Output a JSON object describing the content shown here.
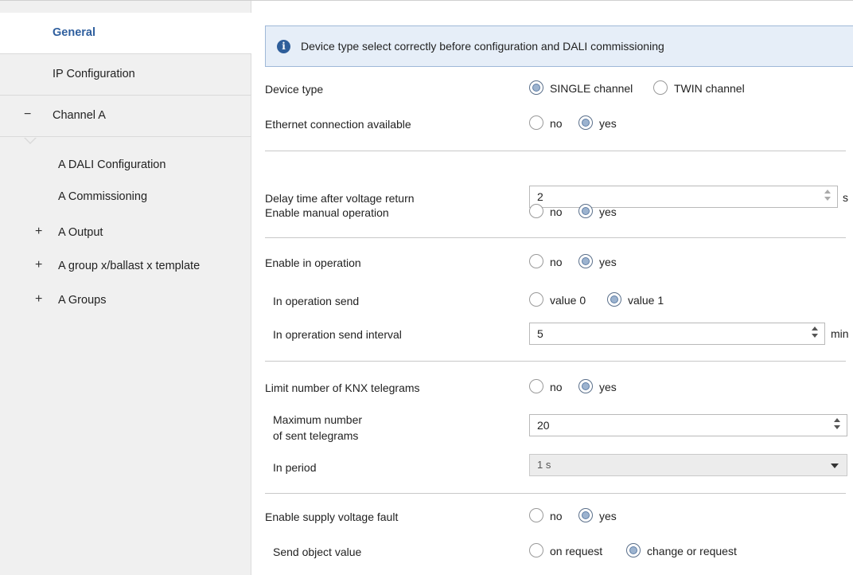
{
  "sidebar": {
    "items": [
      {
        "label": "General"
      },
      {
        "label": "IP Configuration"
      },
      {
        "label": "Channel A",
        "sign": "−"
      },
      {
        "label": "A DALI Configuration"
      },
      {
        "label": "A Commissioning"
      },
      {
        "label": "A Output",
        "sign": "+"
      },
      {
        "label": "A group x/ballast x template",
        "sign": "+"
      },
      {
        "label": "A Groups",
        "sign": "+"
      }
    ]
  },
  "main": {
    "info": {
      "icon": "info-icon",
      "glyph": "i",
      "text": "Device type select correctly before configuration and DALI commissioning"
    },
    "device_type": {
      "label": "Device type",
      "opt1": "SINGLE channel",
      "opt2": "TWIN channel"
    },
    "ethernet": {
      "label": "Ethernet connection available",
      "opt1": "no",
      "opt2": "yes"
    },
    "delay": {
      "label": "Delay time after voltage return",
      "value": "2",
      "unit": "s"
    },
    "manual": {
      "label": "Enable manual operation",
      "opt1": "no",
      "opt2": "yes"
    },
    "in_op": {
      "label": "Enable in operation",
      "opt1": "no",
      "opt2": "yes"
    },
    "in_op_send": {
      "label": "In operation send",
      "opt1": "value 0",
      "opt2": "value 1"
    },
    "in_op_interval": {
      "label": "In opreration send interval",
      "value": "5",
      "unit": "min"
    },
    "limit": {
      "label": "Limit number of KNX telegrams",
      "opt1": "no",
      "opt2": "yes"
    },
    "max_tel": {
      "label1": "Maximum number",
      "label2": "of sent telegrams",
      "value": "20"
    },
    "period": {
      "label": "In period",
      "value": "1 s"
    },
    "supply": {
      "label": "Enable supply voltage fault",
      "opt1": "no",
      "opt2": "yes"
    },
    "send_obj": {
      "label": "Send object value",
      "opt1": "on request",
      "opt2": "change or request"
    }
  },
  "colors": {
    "accent": "#2f5f9e",
    "banner_bg": "#e6eef8",
    "banner_border": "#9fb8d8"
  }
}
